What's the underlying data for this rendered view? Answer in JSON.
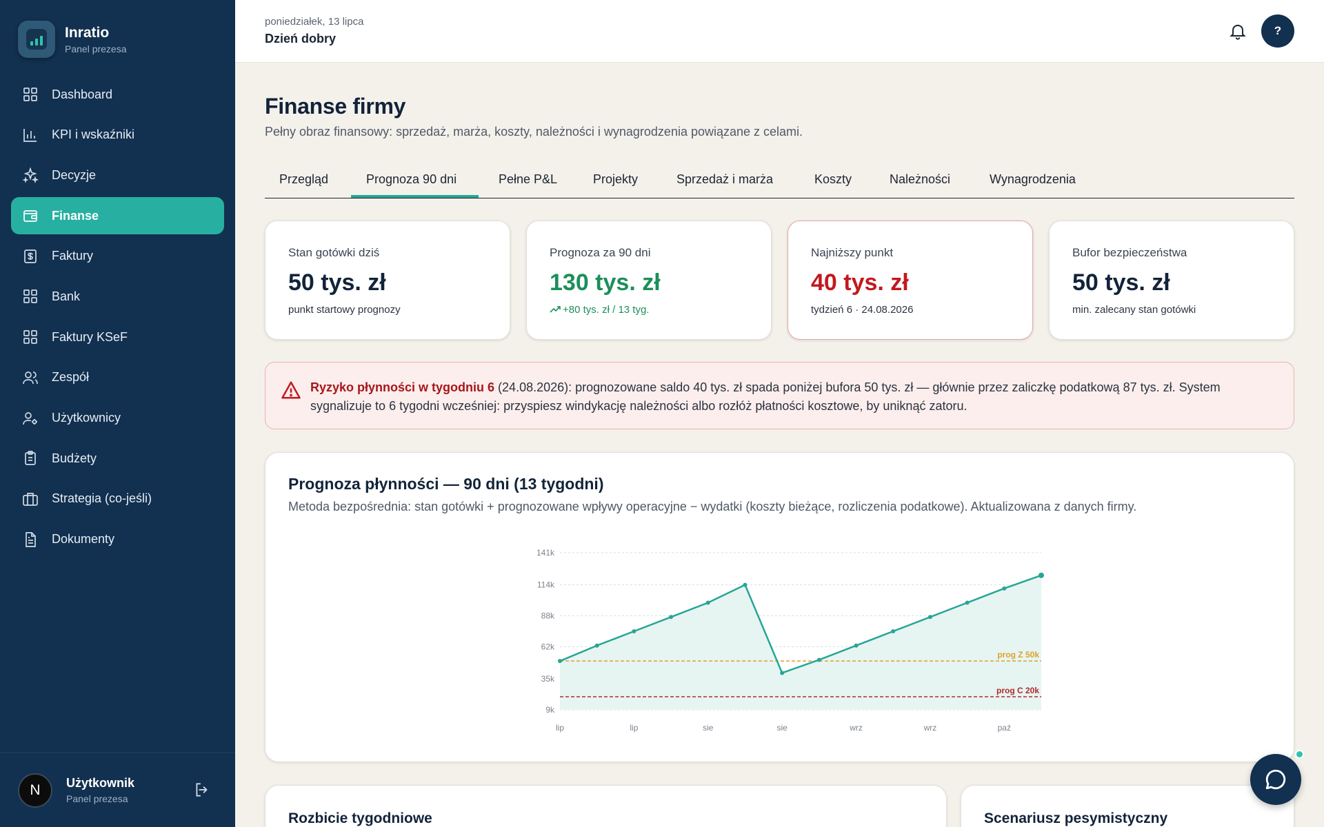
{
  "brand": {
    "name": "Inratio",
    "subtitle": "Panel prezesa"
  },
  "sidebar": {
    "items": [
      {
        "label": "Dashboard",
        "icon": "grid-icon",
        "active": false
      },
      {
        "label": "KPI i wskaźniki",
        "icon": "bar-chart-icon",
        "active": false
      },
      {
        "label": "Decyzje",
        "icon": "sparkles-icon",
        "active": false
      },
      {
        "label": "Finanse",
        "icon": "wallet-icon",
        "active": true
      },
      {
        "label": "Faktury",
        "icon": "invoice-icon",
        "active": false
      },
      {
        "label": "Bank",
        "icon": "grid-icon",
        "active": false
      },
      {
        "label": "Faktury KSeF",
        "icon": "grid-icon",
        "active": false
      },
      {
        "label": "Zespół",
        "icon": "users-icon",
        "active": false
      },
      {
        "label": "Użytkownicy",
        "icon": "user-gear-icon",
        "active": false
      },
      {
        "label": "Budżety",
        "icon": "clipboard-icon",
        "active": false
      },
      {
        "label": "Strategia (co-jeśli)",
        "icon": "briefcase-icon",
        "active": false
      },
      {
        "label": "Dokumenty",
        "icon": "document-icon",
        "active": false
      }
    ]
  },
  "user": {
    "initial": "N",
    "name": "Użytkownik",
    "role": "Panel prezesa"
  },
  "header": {
    "date": "poniedziałek, 13 lipca",
    "greeting": "Dzień dobry",
    "help_label": "?"
  },
  "page": {
    "title": "Finanse firmy",
    "subtitle": "Pełny obraz finansowy: sprzedaż, marża, koszty, należności i wynagrodzenia powiązane z celami."
  },
  "tabs": [
    {
      "label": "Przegląd",
      "active": false
    },
    {
      "label": "Prognoza 90 dni",
      "active": true
    },
    {
      "label": "Pełne P&L",
      "active": false
    },
    {
      "label": "Projekty",
      "active": false
    },
    {
      "label": "Sprzedaż i marża",
      "active": false
    },
    {
      "label": "Koszty",
      "active": false
    },
    {
      "label": "Należności",
      "active": false
    },
    {
      "label": "Wynagrodzenia",
      "active": false
    }
  ],
  "kpis": [
    {
      "label": "Stan gotówki dziś",
      "value": "50 tys. zł",
      "note": "punkt startowy prognozy",
      "tone": "neutral"
    },
    {
      "label": "Prognoza za 90 dni",
      "value": "130 tys. zł",
      "note": "+80 tys. zł / 13 tyg.",
      "tone": "positive"
    },
    {
      "label": "Najniższy punkt",
      "value": "40 tys. zł",
      "note": "tydzień 6 · 24.08.2026",
      "tone": "negative"
    },
    {
      "label": "Bufor bezpieczeństwa",
      "value": "50 tys. zł",
      "note": "min. zalecany stan gotówki",
      "tone": "neutral"
    }
  ],
  "alert": {
    "title": "Ryzyko płynności w tygodniu 6",
    "text": " (24.08.2026): prognozowane saldo 40 tys. zł spada poniżej bufora 50 tys. zł — głównie przez zaliczkę podatkową 87 tys. zł. System sygnalizuje to 6 tygodni wcześniej: przyspiesz windykację należności albo rozłóż płatności kosztowe, by uniknąć zatoru."
  },
  "forecast_card": {
    "title": "Prognoza płynności — 90 dni (13 tygodni)",
    "subtitle": "Metoda bezpośrednia: stan gotówki + prognozowane wpływy operacyjne − wydatki (koszty bieżące, rozliczenia podatkowe). Aktualizowana z danych firmy."
  },
  "chart_data": {
    "type": "area",
    "x": [
      0,
      1,
      2,
      3,
      4,
      5,
      6,
      7,
      8,
      9,
      10,
      11,
      12,
      13
    ],
    "x_tick_labels": [
      "lip",
      "lip",
      "sie",
      "sie",
      "wrz",
      "wrz",
      "paź"
    ],
    "x_tick_positions": [
      0,
      2,
      4,
      6,
      8,
      10,
      12
    ],
    "series": [
      {
        "values": [
          50,
          63,
          75,
          87,
          99,
          114,
          40,
          51,
          63,
          75,
          87,
          99,
          111,
          122
        ]
      }
    ],
    "y_ticks": [
      9,
      35,
      62,
      88,
      114,
      141
    ],
    "y_tick_labels": [
      "9k",
      "35k",
      "62k",
      "88k",
      "114k",
      "141k"
    ],
    "ylim": [
      9,
      141
    ],
    "thresholds": [
      {
        "label": "prog Z 50k",
        "value": 50,
        "color": "#e0a12a"
      },
      {
        "label": "prog C 20k",
        "value": 20,
        "color": "#b3262c"
      }
    ],
    "grid": true,
    "line_color": "#27a597",
    "fill_color": "#e6f5f1"
  },
  "bottom_cards": [
    {
      "title": "Rozbicie tygodniowe"
    },
    {
      "title": "Scenariusz pesymistyczny"
    }
  ],
  "colors": {
    "sidebar_bg": "#12304f",
    "accent": "#27b0a1",
    "positive": "#1b8f5a",
    "negative": "#c2191f"
  }
}
